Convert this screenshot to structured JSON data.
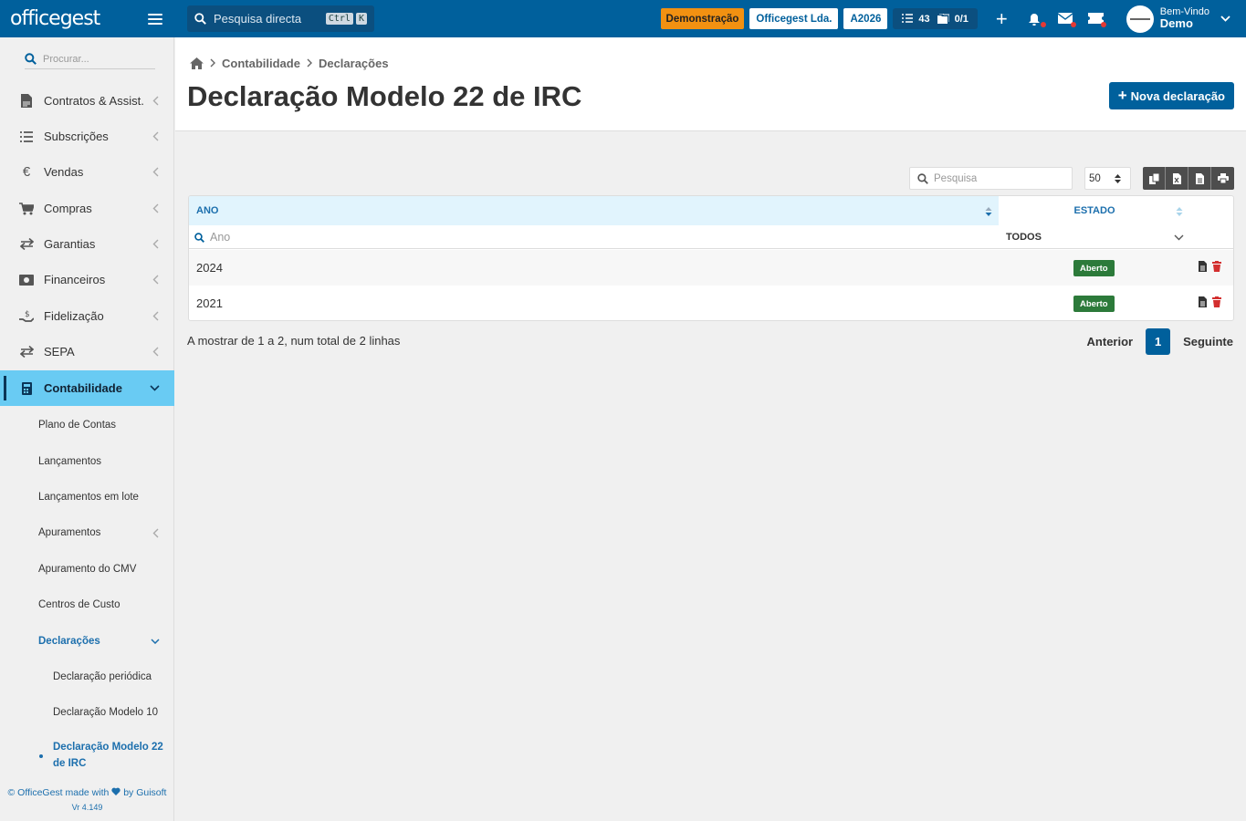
{
  "topbar": {
    "logo": "officegest",
    "search_placeholder": "Pesquisa directa",
    "kbd1": "Ctrl",
    "kbd2": "K",
    "badge_demo": "Demonstração",
    "company": "Officegest Lda.",
    "year": "A2026",
    "tasks_count": "43",
    "docs_count": "0/1",
    "user_greeting": "Bem-Vindo",
    "user_name": "Demo"
  },
  "sidebar": {
    "search_placeholder": "Procurar...",
    "items": [
      {
        "label": "Contratos & Assist."
      },
      {
        "label": "Subscrições"
      },
      {
        "label": "Vendas"
      },
      {
        "label": "Compras"
      },
      {
        "label": "Garantias"
      },
      {
        "label": "Financeiros"
      },
      {
        "label": "Fidelização"
      },
      {
        "label": "SEPA"
      },
      {
        "label": "Contabilidade"
      }
    ],
    "sub_items": [
      {
        "label": "Plano de Contas"
      },
      {
        "label": "Lançamentos"
      },
      {
        "label": "Lançamentos em lote"
      },
      {
        "label": "Apuramentos"
      },
      {
        "label": "Apuramento do CMV"
      },
      {
        "label": "Centros de Custo"
      },
      {
        "label": "Declarações"
      }
    ],
    "sub2_items": [
      {
        "label": "Declaração periódica"
      },
      {
        "label": "Declaração Modelo 10"
      },
      {
        "label": "Declaração Modelo 22 de IRC"
      }
    ],
    "footer_text": "© OfficeGest made with",
    "footer_by": "by Guisoft",
    "version": "Vr 4.149"
  },
  "header": {
    "breadcrumb": [
      "Contabilidade",
      "Declarações"
    ],
    "title": "Declaração Modelo 22 de IRC",
    "new_button": "Nova declaração"
  },
  "table": {
    "search_placeholder": "Pesquisa",
    "page_size": "50",
    "col_ano": "ANO",
    "col_estado": "ESTADO",
    "filter_ano_placeholder": "Ano",
    "filter_estado_value": "TODOS",
    "rows": [
      {
        "ano": "2024",
        "estado": "Aberto"
      },
      {
        "ano": "2021",
        "estado": "Aberto"
      }
    ],
    "info": "A mostrar de 1 a 2, num total de 2 linhas",
    "prev": "Anterior",
    "page": "1",
    "next": "Seguinte"
  },
  "colors": {
    "primary": "#00609c",
    "accent": "#f29111",
    "active_menu": "#69cbf3",
    "status_open": "#2c7a3a",
    "delete": "#d32f2f"
  }
}
